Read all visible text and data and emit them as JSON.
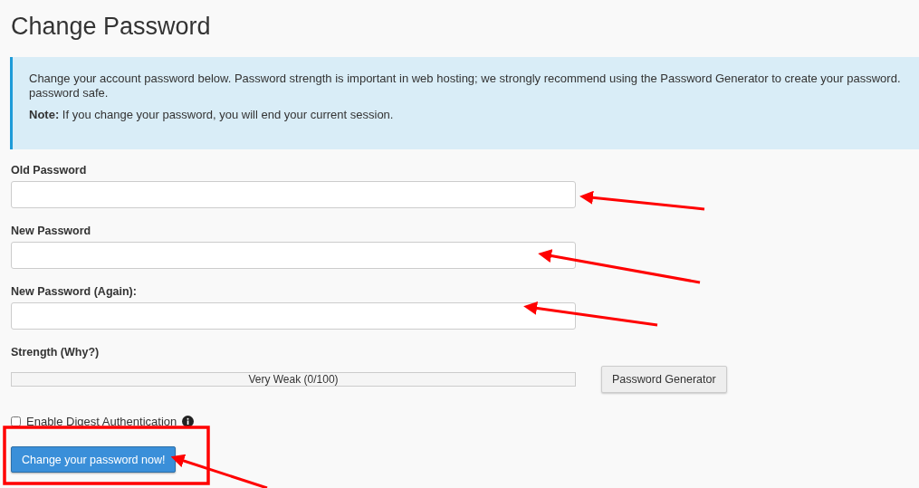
{
  "title": "Change Password",
  "info": {
    "lines": [
      "Change your account password below. Password strength is important in web hosting; we strongly recommend using the Password Generator to create your password.",
      "password safe."
    ],
    "note": "**Note:** If you change your password, you will end your current session."
  },
  "fields": [
    {
      "label": "Old Password"
    },
    {
      "label": "New Password"
    },
    {
      "label": "New Password (Again):"
    }
  ],
  "strength": {
    "label": "Strength (Why?)",
    "reading": "Very Weak (0/100)",
    "level": 0
  },
  "generator_button": "Password Generator",
  "digest": {
    "label": "Enable Digest Authentication",
    "checked": false
  },
  "submit_button": "Change your password now!"
}
